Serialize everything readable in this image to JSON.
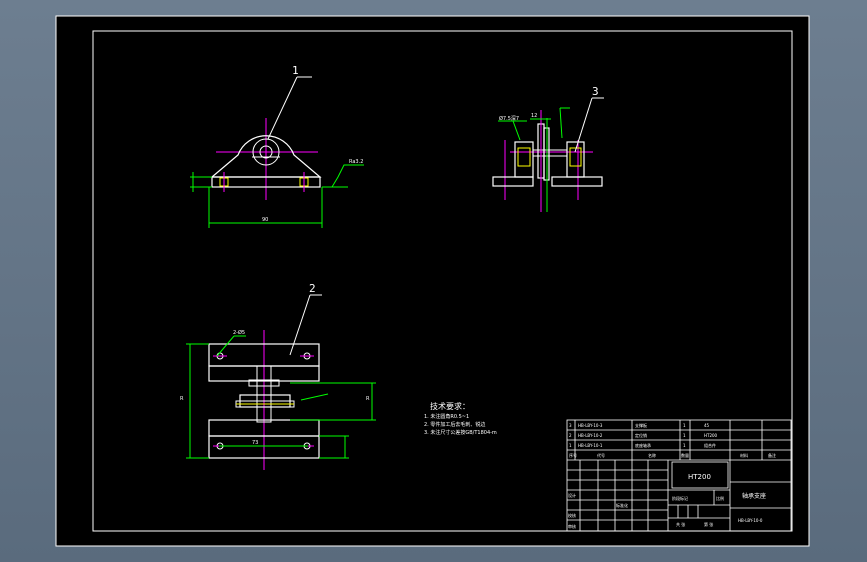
{
  "drawing": {
    "balloons": [
      "1",
      "2",
      "3"
    ],
    "dims": {
      "top_base_width": "90",
      "left_height_r": "R",
      "right_height_r": "R",
      "bottom_hole_span": "73",
      "hole_note": "2-Ø5",
      "surface_note": "Ra3.2",
      "side_note_left": "Ø7.5深7",
      "side_gap": "12"
    }
  },
  "notes": {
    "title": "技术要求：",
    "lines": [
      "1. 未注圆角R0.5~1",
      "2. 零件加工后去毛刺、锐边",
      "3. 未注尺寸公差按GB/T1804-m"
    ]
  },
  "title_block": {
    "parts": [
      {
        "no": "3",
        "code": "HB-LBY-10-3",
        "name": "支撑板",
        "qty": "1",
        "mat": "45"
      },
      {
        "no": "2",
        "code": "HB-LBY-10-2",
        "name": "定位销",
        "qty": "1",
        "mat": "HT200"
      },
      {
        "no": "1",
        "code": "HB-LBY-10-1",
        "name": "底座轴承",
        "qty": "1",
        "mat": "组合件"
      }
    ],
    "header": [
      "序号",
      "代号",
      "名称",
      "数量",
      "材料",
      "备注"
    ],
    "material": "HT200",
    "assembly_name": "轴承支座",
    "drawing_no": "HB-LBY-10-0",
    "scale": "1:1",
    "sign_rows": [
      "设计",
      "校核",
      "审核"
    ],
    "std": "标准化",
    "stage": "阶段标记",
    "weight": "重量",
    "ratio": "比例",
    "sheets": "共 张",
    "sheet": "第 张"
  }
}
